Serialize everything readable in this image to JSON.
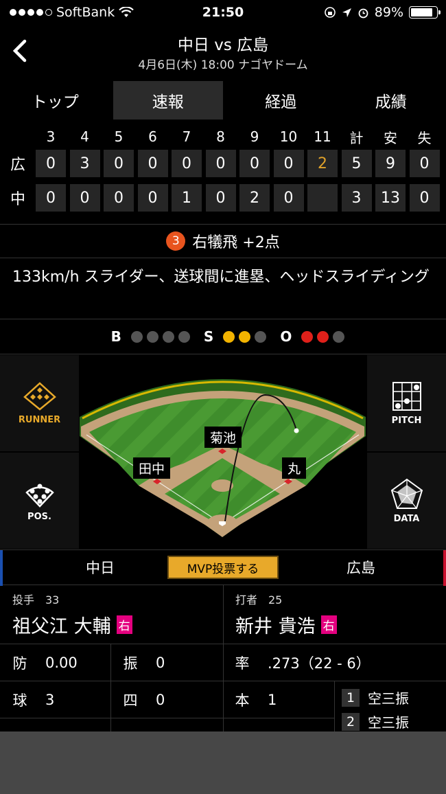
{
  "status_bar": {
    "carrier": "SoftBank",
    "time": "21:50",
    "battery": "89%"
  },
  "header": {
    "title": "中日 vs 広島",
    "subtitle": "4月6日(木) 18:00 ナゴヤドーム"
  },
  "tabs": [
    {
      "label": "トップ",
      "active": false
    },
    {
      "label": "速報",
      "active": true
    },
    {
      "label": "経過",
      "active": false
    },
    {
      "label": "成績",
      "active": false
    }
  ],
  "scoreboard": {
    "headers": [
      "3",
      "4",
      "5",
      "6",
      "7",
      "8",
      "9",
      "10",
      "11",
      "計",
      "安",
      "失"
    ],
    "rows": [
      {
        "team": "広",
        "cells": [
          "0",
          "3",
          "0",
          "0",
          "0",
          "0",
          "0",
          "0",
          "2",
          "5",
          "9",
          "0"
        ]
      },
      {
        "team": "中",
        "cells": [
          "0",
          "0",
          "0",
          "0",
          "1",
          "0",
          "2",
          "0",
          "",
          "3",
          "13",
          "0"
        ]
      }
    ]
  },
  "play": {
    "badge": "3",
    "result": "右犠飛 +2点",
    "description": "133km/h スライダー、送球間に進塁、ヘッドスライディング"
  },
  "count": {
    "b_label": "B",
    "s_label": "S",
    "o_label": "O",
    "balls": 0,
    "strikes": 2,
    "outs": 2
  },
  "side_buttons": {
    "runner": "RUNNER",
    "pitch": "PITCH",
    "pos": "POS.",
    "data": "DATA"
  },
  "field_labels": {
    "cf": "菊池",
    "lf": "田中",
    "rf": "丸"
  },
  "teams": {
    "home": "中日",
    "away": "広島",
    "mvp": "MVP投票する",
    "colors": {
      "home": "#1a4fb0",
      "away": "#c8102e"
    }
  },
  "pitcher": {
    "role": "投手　33",
    "name": "祖父江 大輔",
    "hand": "右",
    "stats": [
      {
        "k": "防",
        "v": "0.00"
      },
      {
        "k": "振",
        "v": "0"
      },
      {
        "k": "球",
        "v": "3"
      },
      {
        "k": "四",
        "v": "0"
      }
    ]
  },
  "batter": {
    "role": "打者　25",
    "name": "新井 貴浩",
    "hand": "右",
    "stats": [
      {
        "k": "率",
        "v": ".273（22 - 6）"
      },
      {
        "k": "本",
        "v": "1"
      }
    ],
    "at_bats": [
      {
        "num": "1",
        "result": "空三振"
      },
      {
        "num": "2",
        "result": "空三振"
      }
    ]
  }
}
